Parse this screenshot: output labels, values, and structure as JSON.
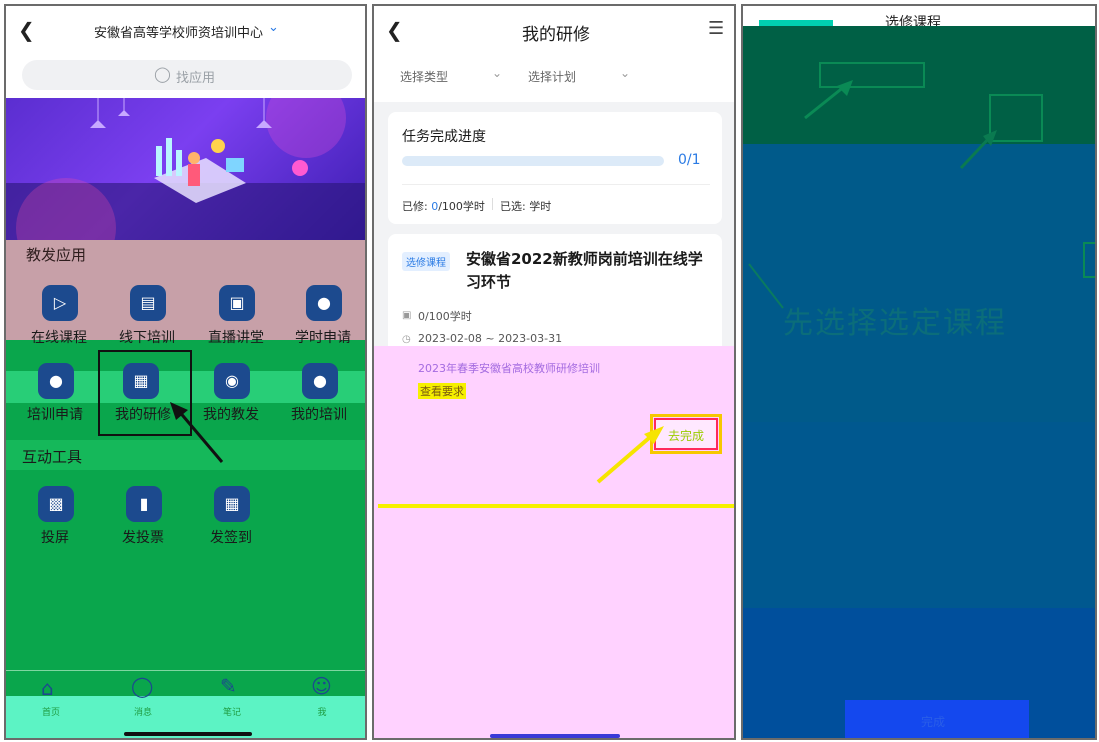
{
  "panel1": {
    "title": "安徽省高等学校师资培训中心",
    "search_placeholder": "找应用",
    "section_teaching": "教发应用",
    "section_tools": "互动工具",
    "apps_row1": [
      "在线课程",
      "线下培训",
      "直播讲堂",
      "学时申请"
    ],
    "apps_row2": [
      "培训申请",
      "我的研修",
      "我的教发",
      "我的培训"
    ],
    "tools": [
      "投屏",
      "发投票",
      "发签到"
    ],
    "tabs": [
      "首页",
      "消息",
      "笔记",
      "我"
    ]
  },
  "panel2": {
    "title": "我的研修",
    "filter_type": "选择类型",
    "filter_plan": "选择计划",
    "progress_title": "任务完成进度",
    "progress_value": "0/1",
    "progress_fraction": 0,
    "studied_label": "已修: ",
    "studied_value": "0",
    "studied_unit": "/100学时",
    "selected_label": "已选: 学时",
    "course_tag": "选修课程",
    "course_title": "安徽省2022新教师岗前培训在线学习环节",
    "course_hours": "0/100学时",
    "course_dates": "2023-02-08 ~ 2023-03-31",
    "course_plan": "2023年春季安徽省高校教师研修培训",
    "view_requirements": "查看要求",
    "complete_button": "去完成"
  },
  "panel3": {
    "title_fragment": "选修课程",
    "watermark_text": "先选择选定课程",
    "button_label": "完成"
  },
  "colors": {
    "green_overlay": "#0aa64c",
    "pink_overlay": "#ffd2ff",
    "highlight_yellow": "#f6f000",
    "accent_blue": "#2b7be4",
    "panel3_blue": "#004f9c"
  }
}
